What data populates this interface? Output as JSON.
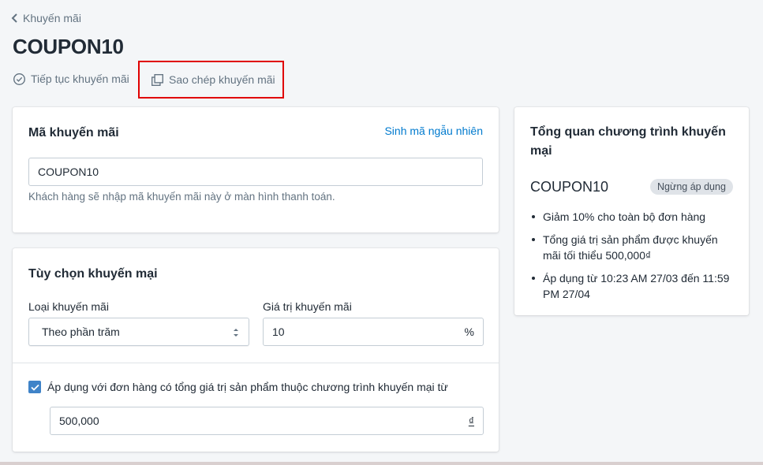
{
  "nav": {
    "back_label": "Khuyến mãi"
  },
  "header": {
    "title": "COUPON10",
    "resume_label": "Tiếp tục khuyến mãi",
    "copy_label": "Sao chép khuyến mãi"
  },
  "code_card": {
    "title": "Mã khuyến mãi",
    "random_link": "Sinh mã ngẫu nhiên",
    "code_value": "COUPON10",
    "help_text": "Khách hàng sẽ nhập mã khuyến mãi này ở màn hình thanh toán."
  },
  "options_card": {
    "title": "Tùy chọn khuyến mại",
    "type_label": "Loại khuyến mãi",
    "type_value": "Theo phần trăm",
    "value_label": "Giá trị khuyến mãi",
    "value": "10",
    "value_suffix": "%",
    "min_checkbox_checked": true,
    "min_checkbox_label": "Áp dụng với đơn hàng có tổng giá trị sản phẩm thuộc chương trình khuyến mại từ",
    "min_value": "500,000",
    "min_suffix": "₫"
  },
  "summary_card": {
    "title": "Tổng quan chương trình khuyến mại",
    "code": "COUPON10",
    "status_badge": "Ngừng áp dụng",
    "items": [
      "Giảm 10% cho toàn bộ đơn hàng",
      "Tổng giá trị sản phẩm được khuyến mãi tối thiểu 500,000₫",
      "Áp dụng từ 10:23 AM 27/03 đến 11:59 PM 27/04"
    ]
  },
  "colors": {
    "accent_link": "#007ace",
    "checkbox": "#3f83c8",
    "highlight_box": "#e00000",
    "page_background": "#f4f6f8"
  }
}
